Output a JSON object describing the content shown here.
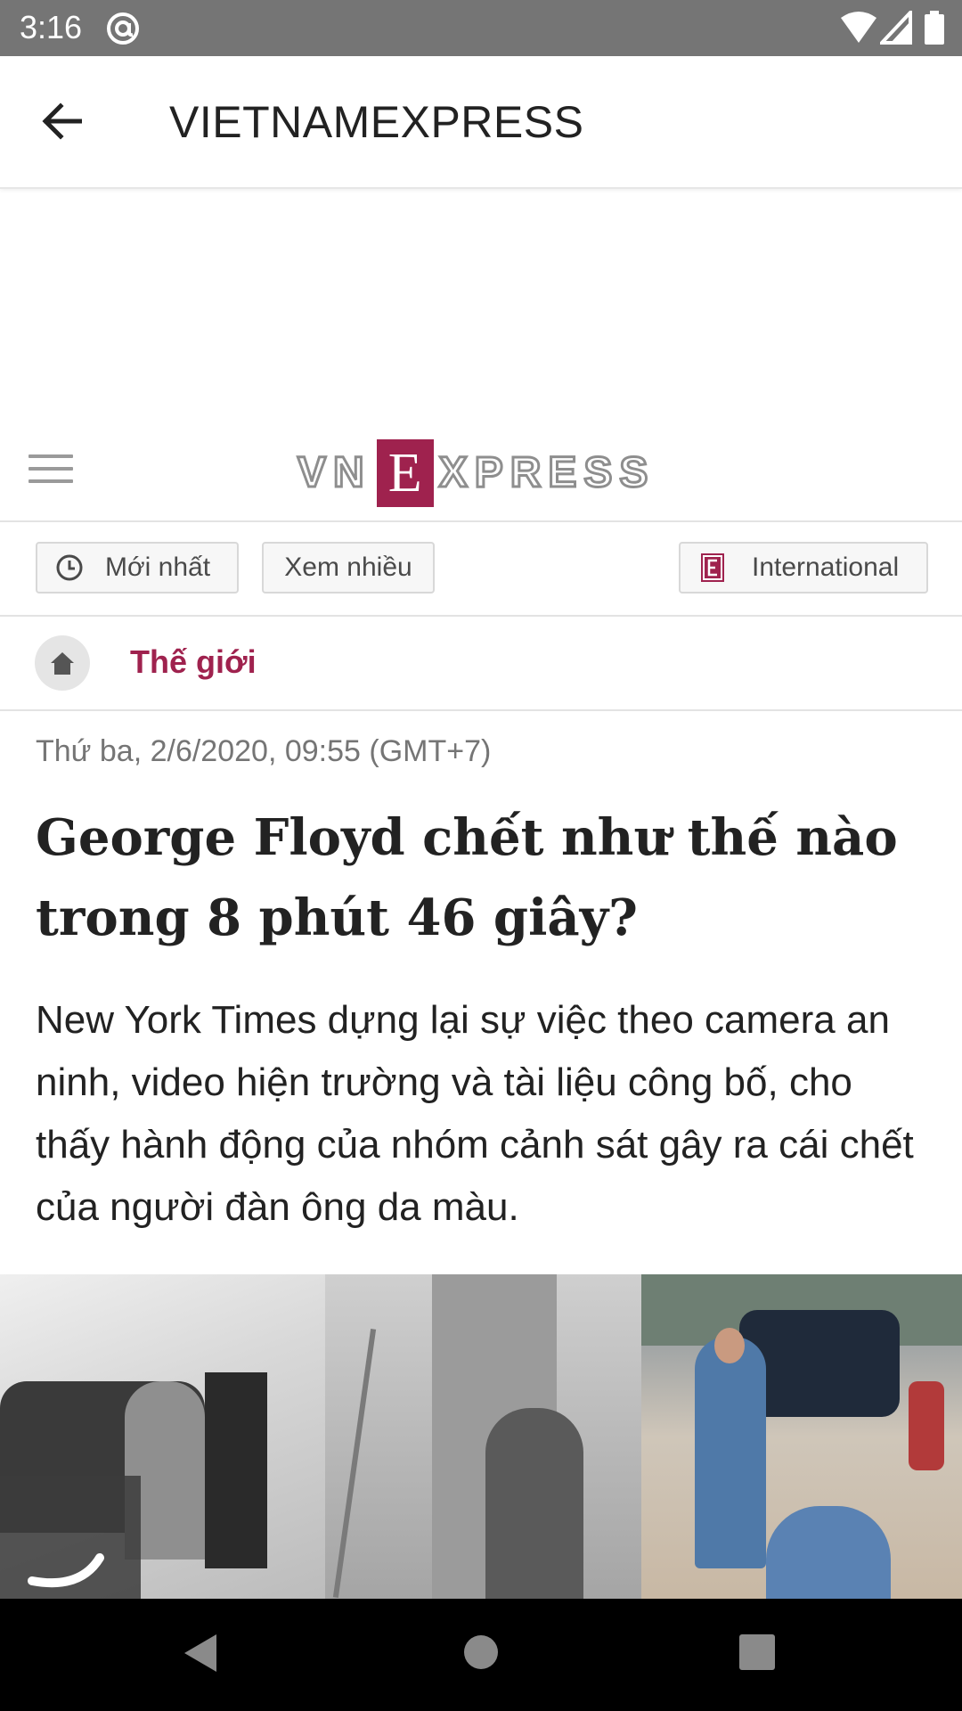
{
  "status_bar": {
    "time": "3:16"
  },
  "app_bar": {
    "title": "VIETNAMEXPRESS"
  },
  "site_header": {
    "logo_left": "VN",
    "logo_e": "E",
    "logo_right": "XPRESS"
  },
  "nav": {
    "latest_label": "Mới nhất",
    "popular_label": "Xem nhiều",
    "international_label": "International"
  },
  "breadcrumb": {
    "category": "Thế giới"
  },
  "article": {
    "date": "Thứ ba, 2/6/2020, 09:55 (GMT+7)",
    "title": "George Floyd chết như thế nào trong 8 phút 46 giây?",
    "lead": "New York Times dựng lại sự việc theo camera an ninh, video hiện trường và tài liệu công bố, cho thấy hành động của nhóm cảnh sát gây ra cái chết của người đàn ông da màu."
  },
  "colors": {
    "brand": "#9f224e",
    "status_bar": "#757575"
  },
  "icons": [
    "at-sign-icon",
    "wifi-icon",
    "cell-signal-icon",
    "battery-icon",
    "back-arrow-icon",
    "hamburger-menu-icon",
    "clock-icon",
    "international-e-icon",
    "home-icon",
    "loading-spinner-icon",
    "nav-back-icon",
    "nav-home-icon",
    "nav-recents-icon"
  ]
}
